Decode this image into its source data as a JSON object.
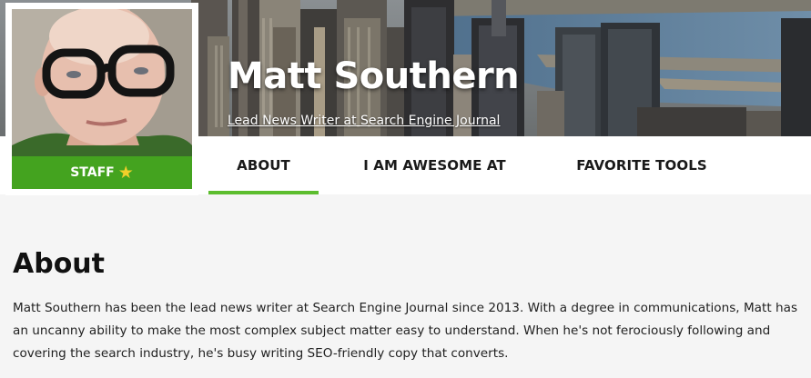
{
  "profile": {
    "name": "Matt Southern",
    "subtitle": "Lead News Writer at Search Engine Journal",
    "badge_label": "STAFF",
    "badge_icon": "star-icon",
    "accent_color": "#5cbd2e"
  },
  "tabs": [
    {
      "label": "ABOUT",
      "active": true
    },
    {
      "label": "I AM AWESOME AT",
      "active": false
    },
    {
      "label": "FAVORITE TOOLS",
      "active": false
    }
  ],
  "about": {
    "heading": "About",
    "body": "Matt Southern has been the lead news writer at Search Engine Journal since 2013. With a degree in communications, Matt has an uncanny ability to make the most complex subject matter easy to understand. When he's not ferociously following and covering the search industry, he's busy writing SEO-friendly copy that converts."
  }
}
